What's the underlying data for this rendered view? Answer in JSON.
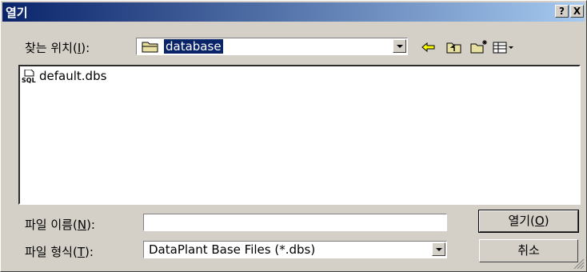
{
  "title": "열기",
  "title_buttons": {
    "help": "?",
    "close": "X"
  },
  "look_in": {
    "label": "찾는 위치(",
    "accel": "I",
    "label_end": "):",
    "value": "database"
  },
  "files": [
    {
      "name": "default.dbs",
      "icon": "sql-file-icon"
    }
  ],
  "filename": {
    "label": "파일 이름(",
    "accel": "N",
    "label_end": "):",
    "value": ""
  },
  "filetype": {
    "label": "파일 형식(",
    "accel": "T",
    "label_end": "):",
    "value": "DataPlant Base Files (*.dbs)"
  },
  "buttons": {
    "open_label": "열기(",
    "open_accel": "O",
    "open_end": ")",
    "cancel_label": "취소"
  },
  "colors": {
    "title_start": "#0a246a",
    "title_end": "#a6caf0",
    "face": "#d4d0c8",
    "selection": "#0a246a"
  }
}
